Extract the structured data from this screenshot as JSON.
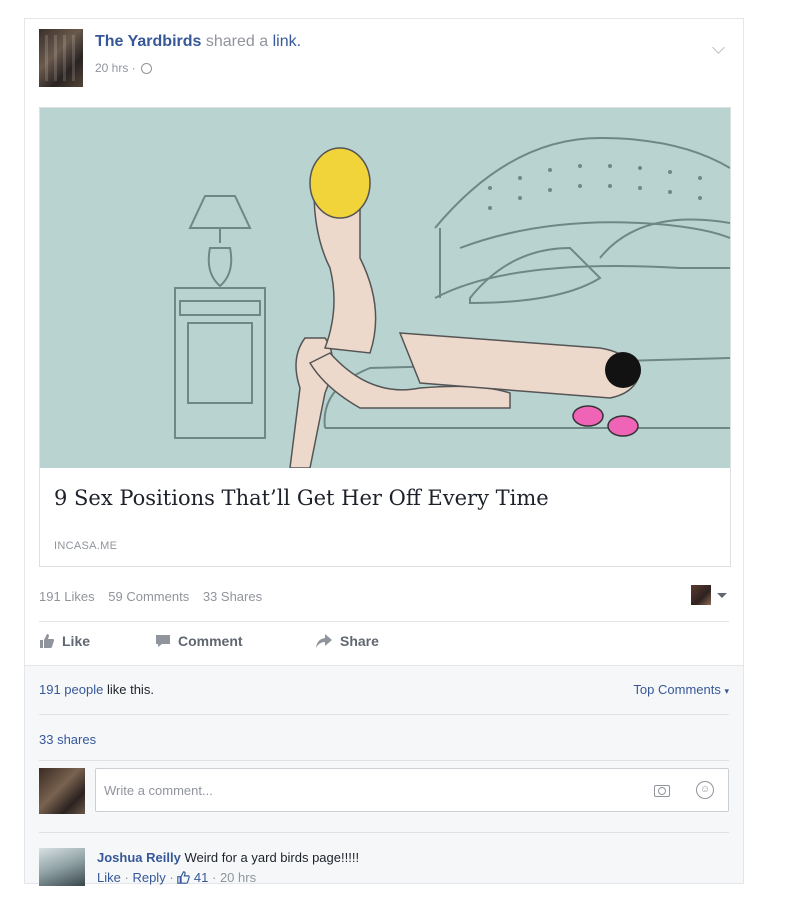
{
  "post": {
    "author": "The Yardbirds",
    "shared_text": "shared a",
    "link_word": "link.",
    "time": "20 hrs ·",
    "link": {
      "title": "9 Sex Positions That’ll Get Her Off Every Time",
      "source": "INCASA.ME"
    },
    "stats": {
      "likes": "191 Likes",
      "comments": "59 Comments",
      "shares": "33 Shares"
    }
  },
  "actions": {
    "like": "Like",
    "comment": "Comment",
    "share": "Share"
  },
  "footer": {
    "likes_count_link": "191 people",
    "likes_suffix": "like this.",
    "top_comments": "Top Comments",
    "shares": "33 shares",
    "write_placeholder": "Write a comment..."
  },
  "comment": {
    "author": "Joshua Reilly",
    "text": "Weird for a yard birds page!!!!!",
    "like": "Like",
    "reply": "Reply",
    "sep": "·",
    "like_count": "41",
    "time": "· 20 hrs"
  },
  "colors": {
    "link_blue": "#365899",
    "muted": "#90949c",
    "image_bg": "#b9d3d0"
  }
}
